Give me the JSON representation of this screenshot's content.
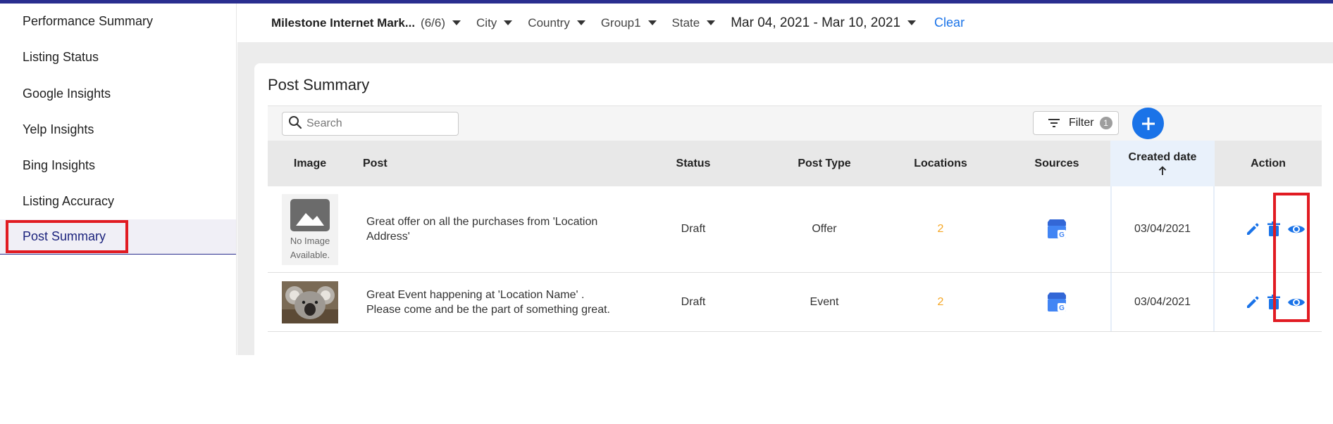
{
  "sidebar": {
    "items": [
      {
        "label": "Performance Summary"
      },
      {
        "label": "Listing Status"
      },
      {
        "label": "Google Insights"
      },
      {
        "label": "Yelp Insights"
      },
      {
        "label": "Bing Insights"
      },
      {
        "label": "Listing Accuracy"
      },
      {
        "label": "Post Summary",
        "active": true
      }
    ]
  },
  "filters": {
    "account": "Milestone Internet Mark...",
    "account_count": "(6/6)",
    "city": "City",
    "country": "Country",
    "group": "Group1",
    "state": "State",
    "date_range": "Mar 04, 2021 - Mar 10, 2021",
    "clear": "Clear"
  },
  "card": {
    "title": "Post Summary",
    "search_placeholder": "Search",
    "filter_label": "Filter",
    "filter_count": "1"
  },
  "table": {
    "headers": {
      "image": "Image",
      "post": "Post",
      "status": "Status",
      "post_type": "Post Type",
      "locations": "Locations",
      "sources": "Sources",
      "created_date": "Created date",
      "action": "Action"
    },
    "rows": [
      {
        "image": "none",
        "image_label": "No Image Available.",
        "post": "Great offer on all the purchases from 'Location Address'",
        "status": "Draft",
        "post_type": "Offer",
        "locations": "2",
        "source_icon": "google-my-business-icon",
        "created_date": "03/04/2021"
      },
      {
        "image": "koala-photo",
        "post": "Great Event happening at 'Location Name' . Please come and be the part of something great.",
        "status": "Draft",
        "post_type": "Event",
        "locations": "2",
        "source_icon": "google-my-business-icon",
        "created_date": "03/04/2021"
      }
    ]
  },
  "colors": {
    "accent": "#1a73e8",
    "nav_active": "#1c237d",
    "highlight_box": "#e11b22",
    "locations": "#f5a623"
  }
}
